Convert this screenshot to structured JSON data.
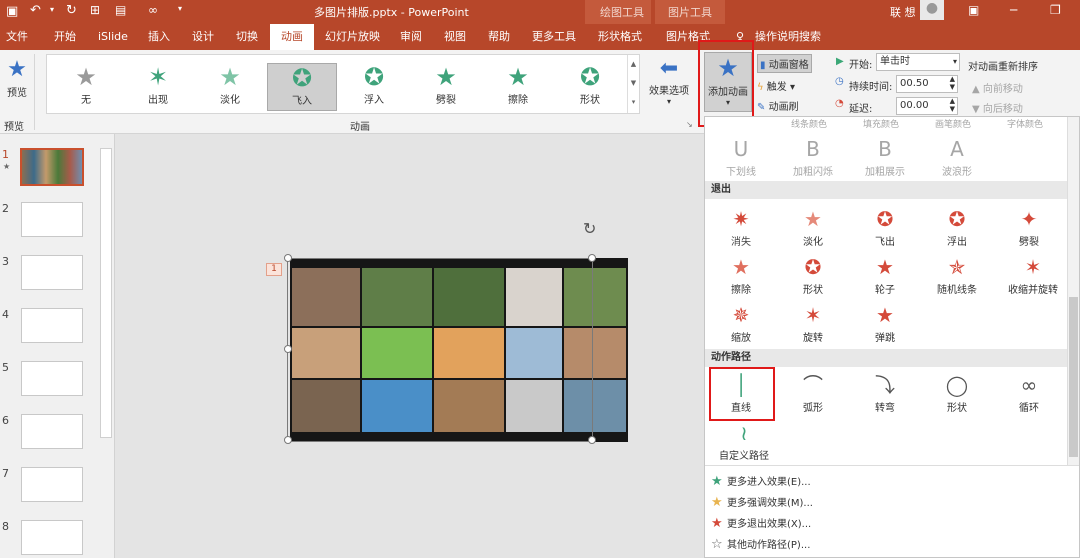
{
  "window": {
    "title": "多图片排版.pptx  -  PowerPoint",
    "context_tools": [
      "绘图工具",
      "图片工具"
    ],
    "user": "联 想"
  },
  "tabs": [
    "文件",
    "开始",
    "iSlide",
    "插入",
    "设计",
    "切换",
    "动画",
    "幻灯片放映",
    "审阅",
    "视图",
    "帮助",
    "更多工具",
    "形状格式",
    "图片格式",
    "操作说明搜索"
  ],
  "active_tab": "动画",
  "ribbon": {
    "preview_label": "预览",
    "preview_group": "预览",
    "animations_group": "动画",
    "gallery": [
      {
        "label": "无",
        "icon": "star-gray-icon",
        "color": "#9a9a9a"
      },
      {
        "label": "出现",
        "icon": "star-burst-icon",
        "color": "#3fa37b"
      },
      {
        "label": "淡化",
        "icon": "star-fade-icon",
        "color": "#7fc4a6"
      },
      {
        "label": "飞入",
        "icon": "star-fly-icon",
        "color": "#3fa37b",
        "selected": true
      },
      {
        "label": "浮入",
        "icon": "star-float-icon",
        "color": "#3fa37b"
      },
      {
        "label": "劈裂",
        "icon": "star-split-icon",
        "color": "#3fa37b"
      },
      {
        "label": "擦除",
        "icon": "star-wipe-icon",
        "color": "#3fa37b"
      },
      {
        "label": "形状",
        "icon": "star-shape-icon",
        "color": "#3fa37b"
      }
    ],
    "effect_options": "效果选项",
    "add_animation": "添加动画",
    "anim_pane": "动画窗格",
    "trigger": "触发",
    "anim_painter": "动画刷",
    "start_label": "开始:",
    "start_value": "单击时",
    "duration_label": "持续时间:",
    "duration_value": "00.50",
    "delay_label": "延迟:",
    "delay_value": "00.00",
    "reorder_title": "对动画重新排序",
    "move_earlier": "向前移动",
    "move_later": "向后移动"
  },
  "slides": [
    "1",
    "2",
    "3",
    "4",
    "5",
    "6",
    "7",
    "8"
  ],
  "slide_tag": "1",
  "dropdown": {
    "top_labels": [
      "线条颜色",
      "填充颜色",
      "画笔颜色",
      "字体颜色"
    ],
    "emphasis_row": [
      {
        "label": "下划线",
        "icon": "U"
      },
      {
        "label": "加粗闪烁",
        "icon": "B"
      },
      {
        "label": "加粗展示",
        "icon": "B"
      },
      {
        "label": "波浪形",
        "icon": "A"
      }
    ],
    "exit_title": "退出",
    "exit": [
      {
        "label": "消失",
        "icon": "✷"
      },
      {
        "label": "淡化",
        "icon": "★"
      },
      {
        "label": "飞出",
        "icon": "✪"
      },
      {
        "label": "浮出",
        "icon": "✪"
      },
      {
        "label": "劈裂",
        "icon": "✦"
      },
      {
        "label": "擦除",
        "icon": "★"
      },
      {
        "label": "形状",
        "icon": "✪"
      },
      {
        "label": "轮子",
        "icon": "★"
      },
      {
        "label": "随机线条",
        "icon": "✯"
      },
      {
        "label": "收缩并旋转",
        "icon": "✶"
      },
      {
        "label": "缩放",
        "icon": "✵"
      },
      {
        "label": "旋转",
        "icon": "✶"
      },
      {
        "label": "弹跳",
        "icon": "★"
      }
    ],
    "path_title": "动作路径",
    "paths": [
      {
        "label": "直线",
        "icon": "│"
      },
      {
        "label": "弧形",
        "icon": "⌒"
      },
      {
        "label": "转弯",
        "icon": "⤵"
      },
      {
        "label": "形状",
        "icon": "◯"
      },
      {
        "label": "循环",
        "icon": "∞"
      },
      {
        "label": "自定义路径",
        "icon": "≀"
      }
    ],
    "more": [
      {
        "label": "更多进入效果(E)...",
        "color": "#3fa37b",
        "icon": "★"
      },
      {
        "label": "更多强调效果(M)...",
        "color": "#e8b450",
        "icon": "★"
      },
      {
        "label": "更多退出效果(X)...",
        "color": "#d44a3a",
        "icon": "★"
      },
      {
        "label": "其他动作路径(P)...",
        "color": "#666666",
        "icon": "☆"
      }
    ]
  }
}
